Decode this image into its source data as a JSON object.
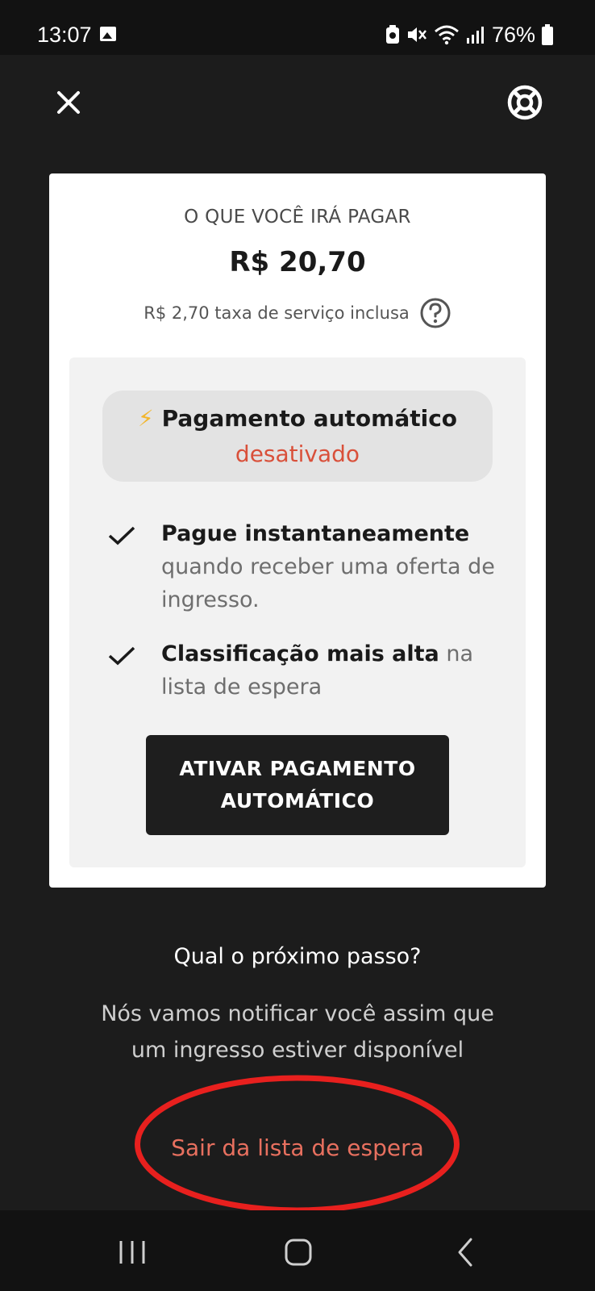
{
  "status_bar": {
    "time": "13:07",
    "battery_percent": "76%",
    "icons": [
      "gallery-icon",
      "storage-icon",
      "mute-icon",
      "wifi-icon",
      "signal-icon",
      "battery-icon"
    ]
  },
  "header": {
    "close_icon": "close-icon",
    "help_icon": "lifebuoy-icon"
  },
  "summary": {
    "title": "O QUE VOCÊ IRÁ PAGAR",
    "price": "R$ 20,70",
    "fee_text": "R$ 2,70 taxa de serviço inclusa",
    "fee_help_icon": "question-icon"
  },
  "autopay": {
    "icon": "lightning-icon",
    "label": "Pagamento automático",
    "status": "desativado",
    "status_color": "#d9503a",
    "benefits": [
      {
        "bold": "Pague instantaneamente",
        "rest": " quando receber uma oferta de ingresso."
      },
      {
        "bold": "Classificação mais alta",
        "rest": " na lista de espera"
      }
    ],
    "button_label": "ATIVAR PAGAMENTO AUTOMÁTICO"
  },
  "next_steps": {
    "title": "Qual o próximo passo?",
    "body": "Nós vamos notificar você assim que um ingresso estiver disponível"
  },
  "leave_link": {
    "label": "Sair da lista de espera",
    "color": "#e8705f"
  },
  "annotation": {
    "color": "#e8201e"
  },
  "nav_bar": {
    "icons": [
      "recent-apps-icon",
      "home-icon",
      "back-icon"
    ]
  }
}
